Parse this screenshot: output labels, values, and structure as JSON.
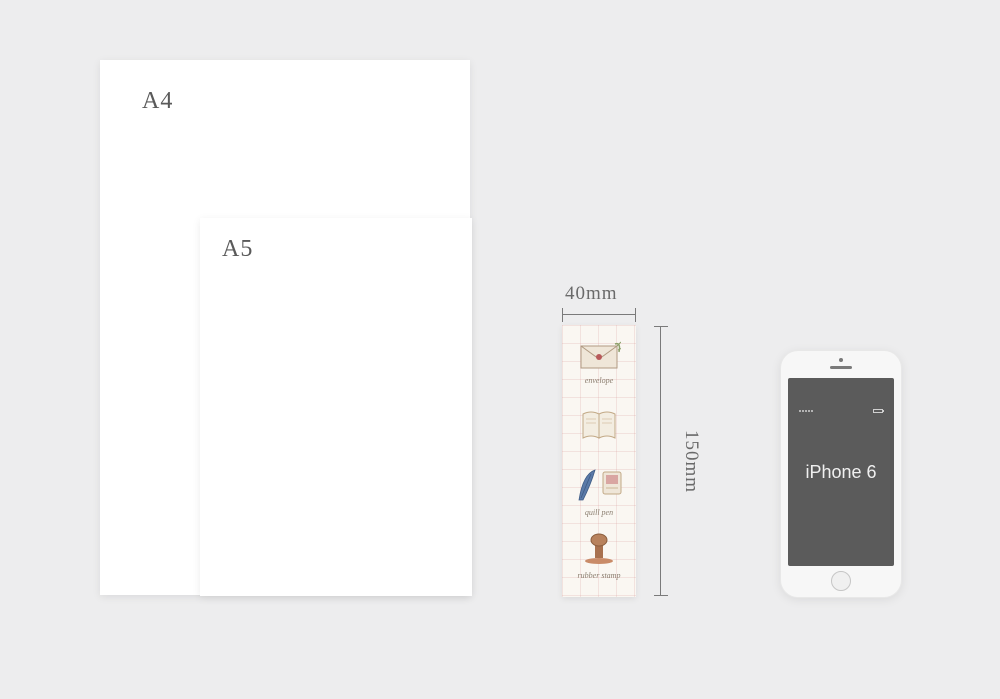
{
  "papers": {
    "a4_label": "A4",
    "a5_label": "A5"
  },
  "dimensions": {
    "width_label": "40mm",
    "height_label": "150mm"
  },
  "bookmark": {
    "items": [
      {
        "caption": "envelope"
      },
      {
        "caption": ""
      },
      {
        "caption": "quill pen"
      },
      {
        "caption": "rubber stamp"
      }
    ]
  },
  "phone": {
    "label": "iPhone 6"
  }
}
